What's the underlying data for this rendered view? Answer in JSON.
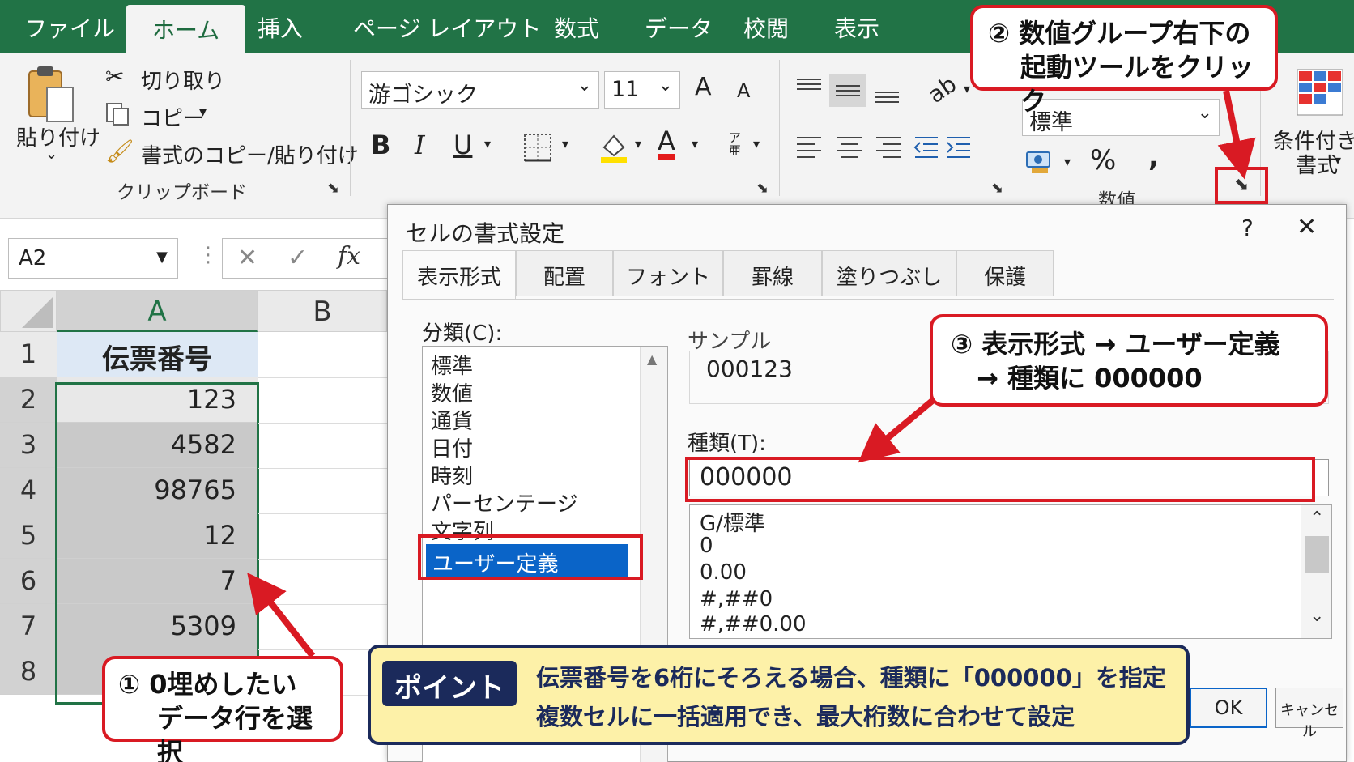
{
  "ribbon": {
    "tabs": [
      "ファイル",
      "ホーム",
      "挿入",
      "ページ レイアウト",
      "数式",
      "データ",
      "校閲",
      "表示"
    ],
    "active_tab": "ホーム",
    "clipboard": {
      "paste": "貼り付け",
      "cut": "切り取り",
      "copy": "コピー",
      "format_painter": "書式のコピー/貼り付け",
      "group_label": "クリップボード"
    },
    "font": {
      "name": "游ゴシック",
      "size": "11",
      "grow": "A",
      "shrink": "A",
      "bold": "B",
      "italic": "I",
      "underline": "U",
      "color_letter": "A",
      "phonetic": "ア亜"
    },
    "number": {
      "format": "標準",
      "percent": "%",
      "comma": ",",
      "group_label": "数値"
    },
    "styles": {
      "conditional_line1": "条件付き",
      "conditional_line2": "書式"
    },
    "colors": {
      "ribbon_green": "#217346",
      "accent_red": "#d91a23",
      "select_blue": "#0a64c8"
    }
  },
  "formula_bar": {
    "name_box": "A2",
    "cancel": "✕",
    "enter": "✓",
    "fx": "fx"
  },
  "sheet": {
    "columns": [
      "A",
      "B"
    ],
    "rows": [
      "1",
      "2",
      "3",
      "4",
      "5",
      "6",
      "7",
      "8"
    ],
    "header_cell": "伝票番号",
    "values": [
      "123",
      "4582",
      "98765",
      "12",
      "7",
      "5309"
    ]
  },
  "dialog": {
    "title": "セルの書式設定",
    "help": "?",
    "close": "✕",
    "tabs": [
      "表示形式",
      "配置",
      "フォント",
      "罫線",
      "塗りつぶし",
      "保護"
    ],
    "category_label": "分類(C):",
    "categories": [
      "標準",
      "数値",
      "通貨",
      "日付",
      "時刻",
      "パーセンテージ",
      "文字列",
      "ユーザー定義"
    ],
    "selected_category": "ユーザー定義",
    "sample_label": "サンプル",
    "sample_value": "000123",
    "type_label": "種類(T):",
    "type_value": "000000",
    "formats": [
      "G/標準",
      "0",
      "0.00",
      "#,##0",
      "#,##0.00"
    ],
    "ok": "OK",
    "cancel": "キャンセル"
  },
  "callouts": {
    "step1_line1": "① 0埋めしたい",
    "step1_line2": "データ行を選択",
    "step2_line1": "② 数値グループ右下の",
    "step2_line2": "起動ツールをクリック",
    "step3_line1": "③ 表示形式 → ユーザー定義",
    "step3_line2": "→ 種類に 000000",
    "point_tag": "ポイント",
    "point_line1": "伝票番号を6桁にそろえる場合、種類に「000000」を指定",
    "point_line2": "複数セルに一括適用でき、最大桁数に合わせて設定"
  }
}
